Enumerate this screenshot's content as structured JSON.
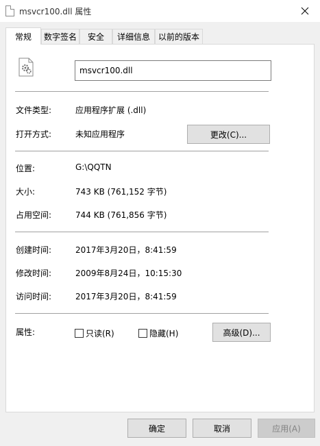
{
  "window": {
    "title": "msvcr100.dll 属性"
  },
  "tabs": [
    {
      "label": "常规",
      "active": true
    },
    {
      "label": "数字签名"
    },
    {
      "label": "安全"
    },
    {
      "label": "详细信息"
    },
    {
      "label": "以前的版本"
    }
  ],
  "general": {
    "file_name": "msvcr100.dll",
    "file_type_label": "文件类型:",
    "file_type_value": "应用程序扩展 (.dll)",
    "open_with_label": "打开方式:",
    "open_with_value": "未知应用程序",
    "change_button": "更改(C)...",
    "location_label": "位置:",
    "location_value": "G:\\QQTN",
    "size_label": "大小:",
    "size_value": "743 KB (761,152 字节)",
    "size_on_disk_label": "占用空间:",
    "size_on_disk_value": "744 KB (761,856 字节)",
    "created_label": "创建时间:",
    "created_value": "2017年3月20日，8:41:59",
    "modified_label": "修改时间:",
    "modified_value": "2009年8月24日，10:15:30",
    "accessed_label": "访问时间:",
    "accessed_value": "2017年3月20日，8:41:59",
    "attributes_label": "属性:",
    "readonly_label": "只读(R)",
    "hidden_label": "隐藏(H)",
    "advanced_button": "高级(D)..."
  },
  "footer": {
    "ok": "确定",
    "cancel": "取消",
    "apply": "应用(A)"
  },
  "colors": {
    "window_bg": "#f0f0f0",
    "button_bg": "#e1e1e1",
    "disabled_text": "#838383"
  },
  "icons": {
    "title": "dll-file-icon",
    "file": "dll-file-gear-icon",
    "close": "close-icon"
  }
}
